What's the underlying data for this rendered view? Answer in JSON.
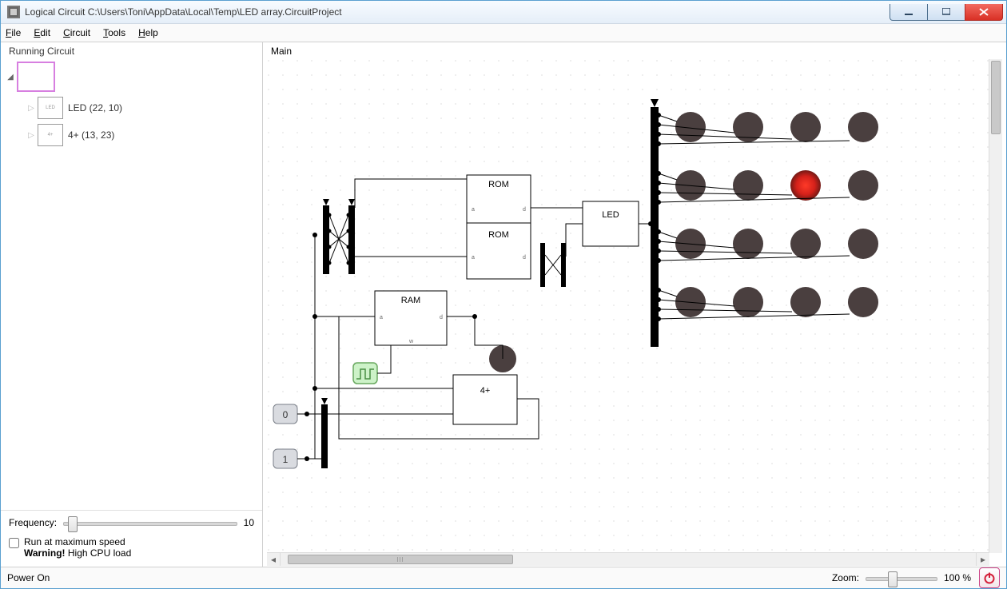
{
  "window": {
    "title": "Logical Circuit C:\\Users\\Toni\\AppData\\Local\\Temp\\LED array.CircuitProject"
  },
  "menu": {
    "file": "File",
    "edit": "Edit",
    "circuit": "Circuit",
    "tools": "Tools",
    "help": "Help"
  },
  "left": {
    "heading": "Running Circuit",
    "items": [
      {
        "label": ""
      },
      {
        "label": "LED  (22, 10)"
      },
      {
        "label": "4+  (13, 23)"
      }
    ],
    "frequency_label": "Frequency:",
    "frequency_value": "10",
    "run_max_label": "Run at maximum speed",
    "warning_prefix": "Warning!",
    "warning_rest": " High CPU load"
  },
  "main": {
    "heading": "Main",
    "components": {
      "rom1": "ROM",
      "rom2": "ROM",
      "ram": "RAM",
      "led": "LED",
      "adder": "4+",
      "pin0": "0",
      "pin1": "1",
      "port_a": "a",
      "port_d": "d",
      "port_w": "w"
    }
  },
  "status": {
    "power": "Power On",
    "zoom_label": "Zoom:",
    "zoom_value": "100 %"
  },
  "colors": {
    "led_off": "#4a3f3f",
    "led_on_center": "#ff2a1a",
    "led_on_mid": "#c61a10",
    "clock_fill": "#cdf2c8",
    "clock_stroke": "#6aa960"
  }
}
